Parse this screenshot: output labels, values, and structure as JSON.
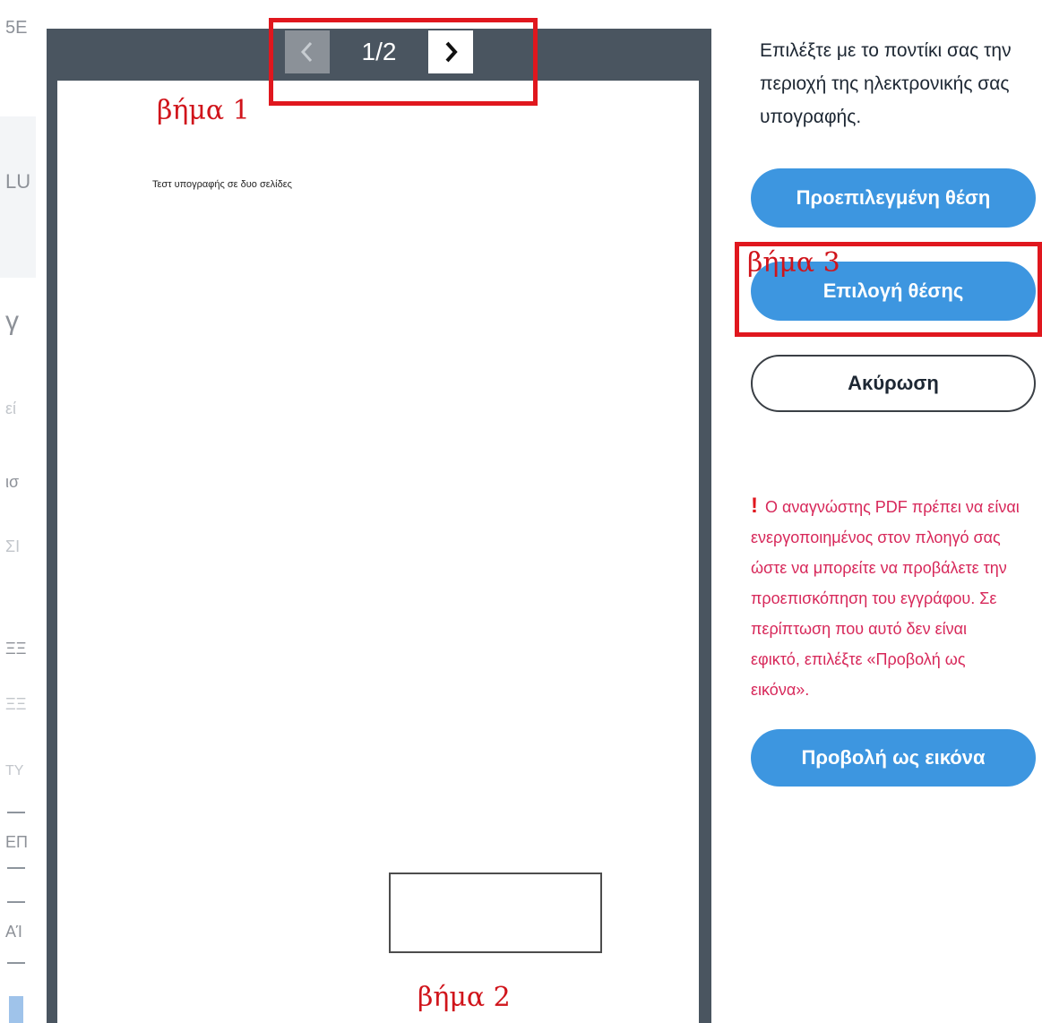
{
  "left_fragments": [
    "5E",
    "LU",
    "γ",
    "εί",
    "ισ",
    "ΣΙ",
    "ΞΞ",
    "ΞΞ",
    "ΤΥ",
    "ΕΠ",
    "ΑΊ"
  ],
  "viewer": {
    "page_indicator": "1/2",
    "prev_icon": "chevron-left-icon",
    "next_icon": "chevron-right-icon",
    "document_text": "Τεστ υπογραφής σε δυο σελίδες"
  },
  "annotations": {
    "step1": "βήμα 1",
    "step2": "βήμα 2",
    "step3": "βήμα 3",
    "color": "#e0171e"
  },
  "panel": {
    "instruction": "Επιλέξτε με το ποντίκι σας την περιοχή της ηλεκτρονικής σας υπογραφής.",
    "default_position_label": "Προεπιλεγμένη θέση",
    "choose_position_label": "Επιλογή θέσης",
    "cancel_label": "Ακύρωση",
    "warning_mark": "!",
    "warning_text": "Ο αναγνώστης PDF πρέπει να είναι ενεργοποιημένος στον πλοηγό σας ώστε να μπορείτε να προβάλετε την προεπισκόπηση του εγγράφου. Σε περίπτωση που αυτό δεν είναι εφικτό, επιλέξτε «Προβολή ως εικόνα».",
    "view_as_image_label": "Προβολή ως εικόνα"
  },
  "colors": {
    "primary_button": "#3d96e0",
    "warning_text": "#d7285a",
    "viewer_frame": "#4a5560"
  }
}
